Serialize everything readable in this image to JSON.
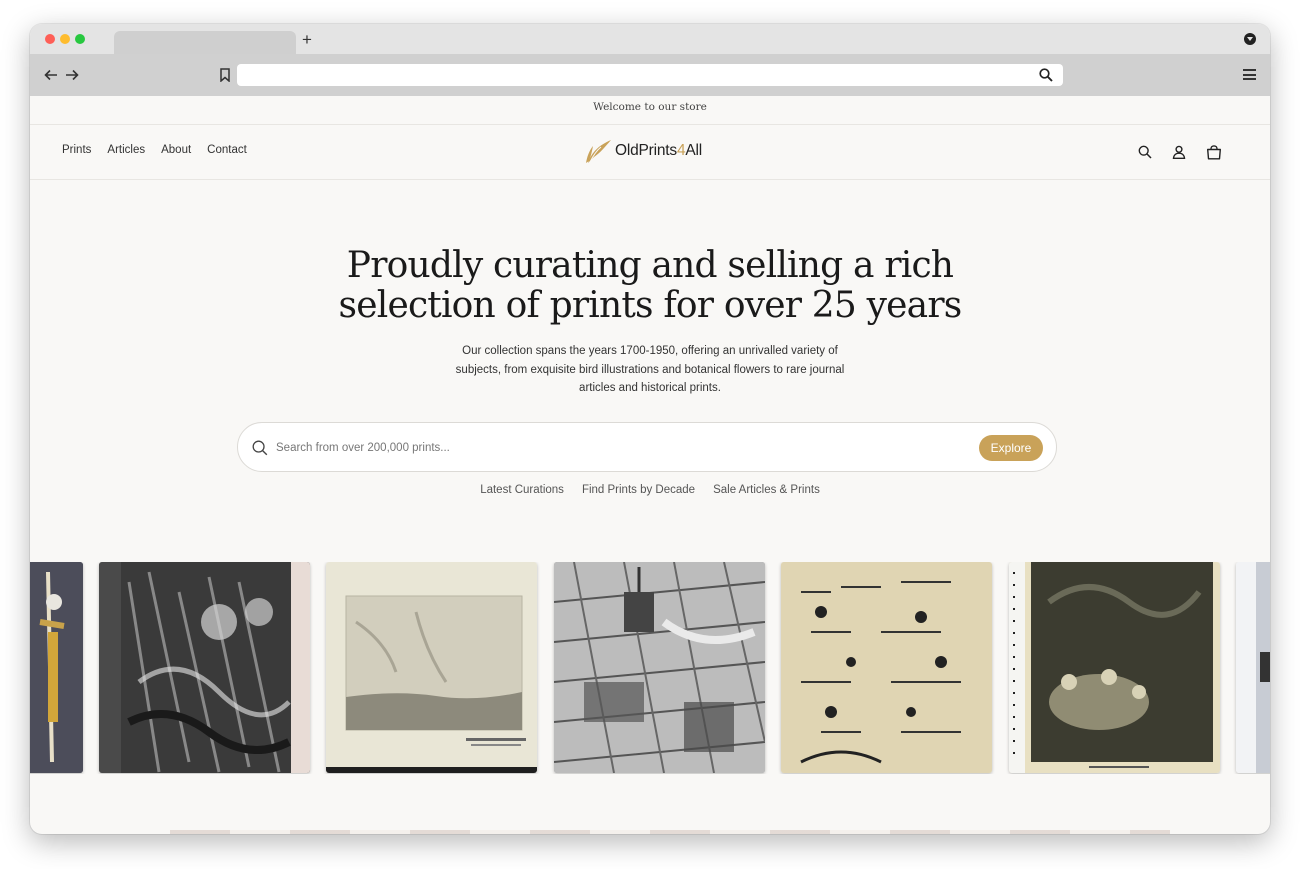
{
  "browser": {
    "new_tab": "+"
  },
  "announcement": "Welcome to our store",
  "nav": {
    "items": [
      "Prints",
      "Articles",
      "About",
      "Contact"
    ]
  },
  "logo": {
    "text_a": "OldPrints",
    "text_b": "4",
    "text_c": "All",
    "accent_color": "#c9a259"
  },
  "header_icons": [
    "search-icon",
    "account-icon",
    "cart-icon"
  ],
  "hero": {
    "title_line1": "Proudly curating and selling a rich",
    "title_line2": "selection of prints for over 25 years",
    "description": "Our collection spans the years 1700-1950, offering an unrivalled variety of subjects, from exquisite bird illustrations and botanical flowers to rare journal articles and historical prints."
  },
  "search": {
    "placeholder": "Search from over 200,000 prints...",
    "value": "",
    "button": "Explore"
  },
  "quick_links": [
    "Latest Curations",
    "Find Prints by Decade",
    "Sale Articles & Prints"
  ],
  "gallery": {
    "items": [
      "print-figure-sword",
      "print-victorian-street",
      "print-landscape-etching",
      "print-city-aerial",
      "print-cartoon-page",
      "print-forest-gathering",
      "print-partial"
    ]
  }
}
